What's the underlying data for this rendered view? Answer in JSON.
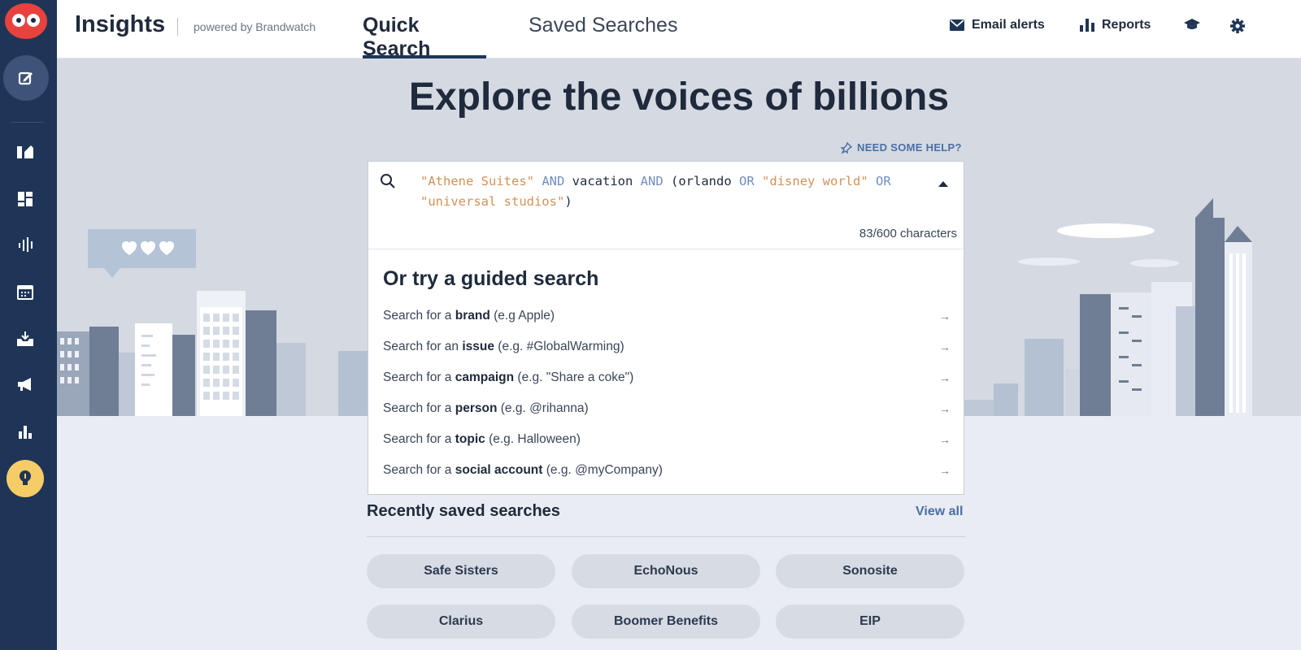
{
  "app": {
    "name": "Insights",
    "powered_by": "powered by Brandwatch"
  },
  "tabs": [
    {
      "label": "Quick Search",
      "active": true
    },
    {
      "label": "Saved Searches",
      "active": false
    }
  ],
  "topnav": {
    "email_alerts": "Email alerts",
    "reports": "Reports"
  },
  "sidebar": {
    "icons": [
      "owl-logo-icon",
      "compose-icon",
      "streams-icon",
      "dashboard-icon",
      "analytics-icon",
      "calendar-icon",
      "inbox-icon",
      "campaigns-icon",
      "reports-icon",
      "lightbulb-icon"
    ]
  },
  "hero": {
    "headline": "Explore the voices of billions",
    "help_link": "NEED SOME HELP?"
  },
  "search": {
    "query_parts": {
      "s1": "\"Athene Suites\"",
      "o1": "AND",
      "t1": "vacation",
      "o2": "AND",
      "t2": "(orlando",
      "o3": "OR",
      "s2": "\"disney world\"",
      "o4": "OR",
      "s3": "\"universal studios\"",
      "t3": ")"
    },
    "char_count": "83/600 characters"
  },
  "guided": {
    "title": "Or try a guided search",
    "items": [
      {
        "prefix": "Search for a ",
        "keyword": "brand",
        "example": " (e.g Apple)"
      },
      {
        "prefix": "Search for an ",
        "keyword": "issue",
        "example": " (e.g. #GlobalWarming)"
      },
      {
        "prefix": "Search for a ",
        "keyword": "campaign",
        "example": " (e.g. \"Share a coke\")"
      },
      {
        "prefix": "Search for a ",
        "keyword": "person",
        "example": " (e.g. @rihanna)"
      },
      {
        "prefix": "Search for a ",
        "keyword": "topic",
        "example": " (e.g. Halloween)"
      },
      {
        "prefix": "Search for a ",
        "keyword": "social account",
        "example": " (e.g. @myCompany)"
      }
    ],
    "arrow": "→"
  },
  "recent": {
    "title": "Recently saved searches",
    "view_all": "View all",
    "items": [
      "Safe Sisters",
      "EchoNous",
      "Sonosite",
      "Clarius",
      "Boomer Benefits",
      "EIP"
    ]
  },
  "colors": {
    "sidebar": "#1f3557",
    "accent": "#4a6fa5",
    "hero_bg": "#d5d9e2",
    "owl": "#e8423f",
    "highlight": "#f6cc66"
  }
}
